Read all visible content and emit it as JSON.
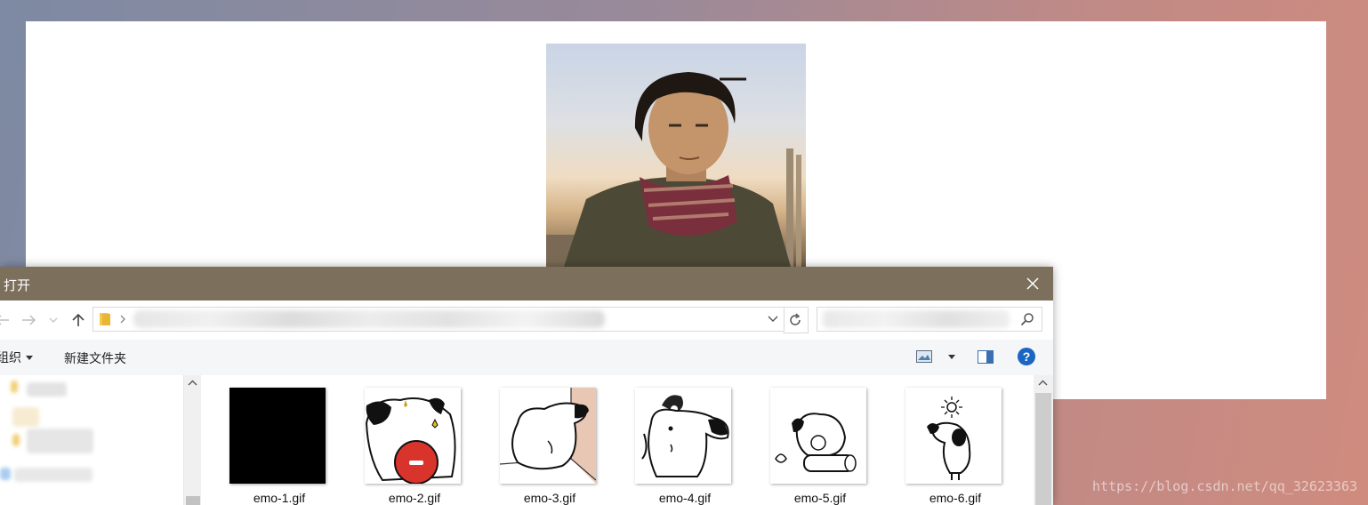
{
  "dialog": {
    "title": "打开",
    "toolbar": {
      "organize_label": "组织",
      "new_folder_label": "新建文件夹"
    },
    "files": [
      {
        "name": "emo-1.gif"
      },
      {
        "name": "emo-2.gif"
      },
      {
        "name": "emo-3.gif"
      },
      {
        "name": "emo-4.gif"
      },
      {
        "name": "emo-5.gif"
      },
      {
        "name": "emo-6.gif"
      }
    ]
  },
  "watermark": "https://blog.csdn.net/qq_32623363",
  "colors": {
    "titlebar": "#7c6f5c",
    "help_icon": "#1a66c2",
    "emo2_ball": "#d8342c"
  },
  "icons": [
    "close-icon",
    "back-arrow-icon",
    "forward-arrow-icon",
    "up-arrow-icon",
    "folder-icon",
    "refresh-icon",
    "search-icon",
    "view-icon",
    "preview-pane-icon",
    "help-icon",
    "scroll-up-icon"
  ]
}
